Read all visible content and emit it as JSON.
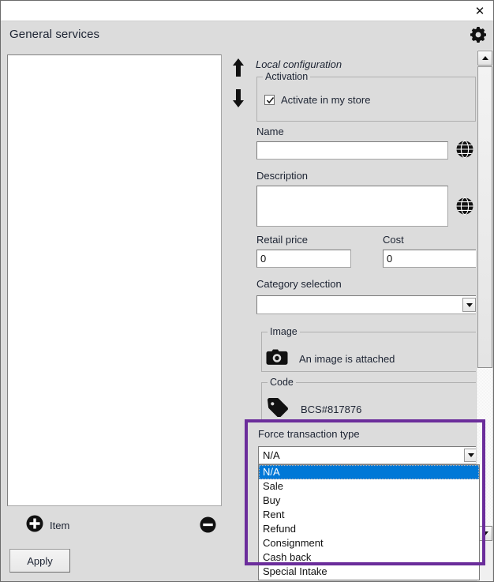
{
  "window": {
    "close_label": "✕"
  },
  "panel": {
    "title": "General services",
    "settings_icon": "gear-icon"
  },
  "left": {
    "sort_up_icon": "arrow-up-icon",
    "sort_down_icon": "arrow-down-icon",
    "add_label": "Item",
    "add_icon": "plus-circle-icon",
    "remove_icon": "minus-circle-icon",
    "apply_label": "Apply"
  },
  "config": {
    "section_label": "Local configuration",
    "activation": {
      "legend": "Activation",
      "checkbox_label": "Activate in my store",
      "checked": true
    },
    "name": {
      "label": "Name",
      "value": "",
      "translate_icon": "globe-icon"
    },
    "description": {
      "label": "Description",
      "value": "",
      "translate_icon": "globe-icon"
    },
    "retail_price": {
      "label": "Retail price",
      "value": "0"
    },
    "cost": {
      "label": "Cost",
      "value": "0"
    },
    "category": {
      "label": "Category selection",
      "value": ""
    },
    "image": {
      "legend": "Image",
      "icon": "camera-icon",
      "text": "An image is attached"
    },
    "code": {
      "legend": "Code",
      "icon": "tag-icon",
      "text": "BCS#817876"
    },
    "force_transaction_type": {
      "label": "Force transaction type",
      "selected": "N/A",
      "options": [
        "N/A",
        "Sale",
        "Buy",
        "Rent",
        "Refund",
        "Consignment",
        "Cash back",
        "Special Intake"
      ]
    }
  },
  "scrollbar": {
    "up_icon": "triangle-up-icon",
    "down_icon": "triangle-down-icon"
  },
  "colors": {
    "highlight_border": "#6b2d9b",
    "selection": "#0078d7",
    "window_bg": "#dcdcdc"
  }
}
